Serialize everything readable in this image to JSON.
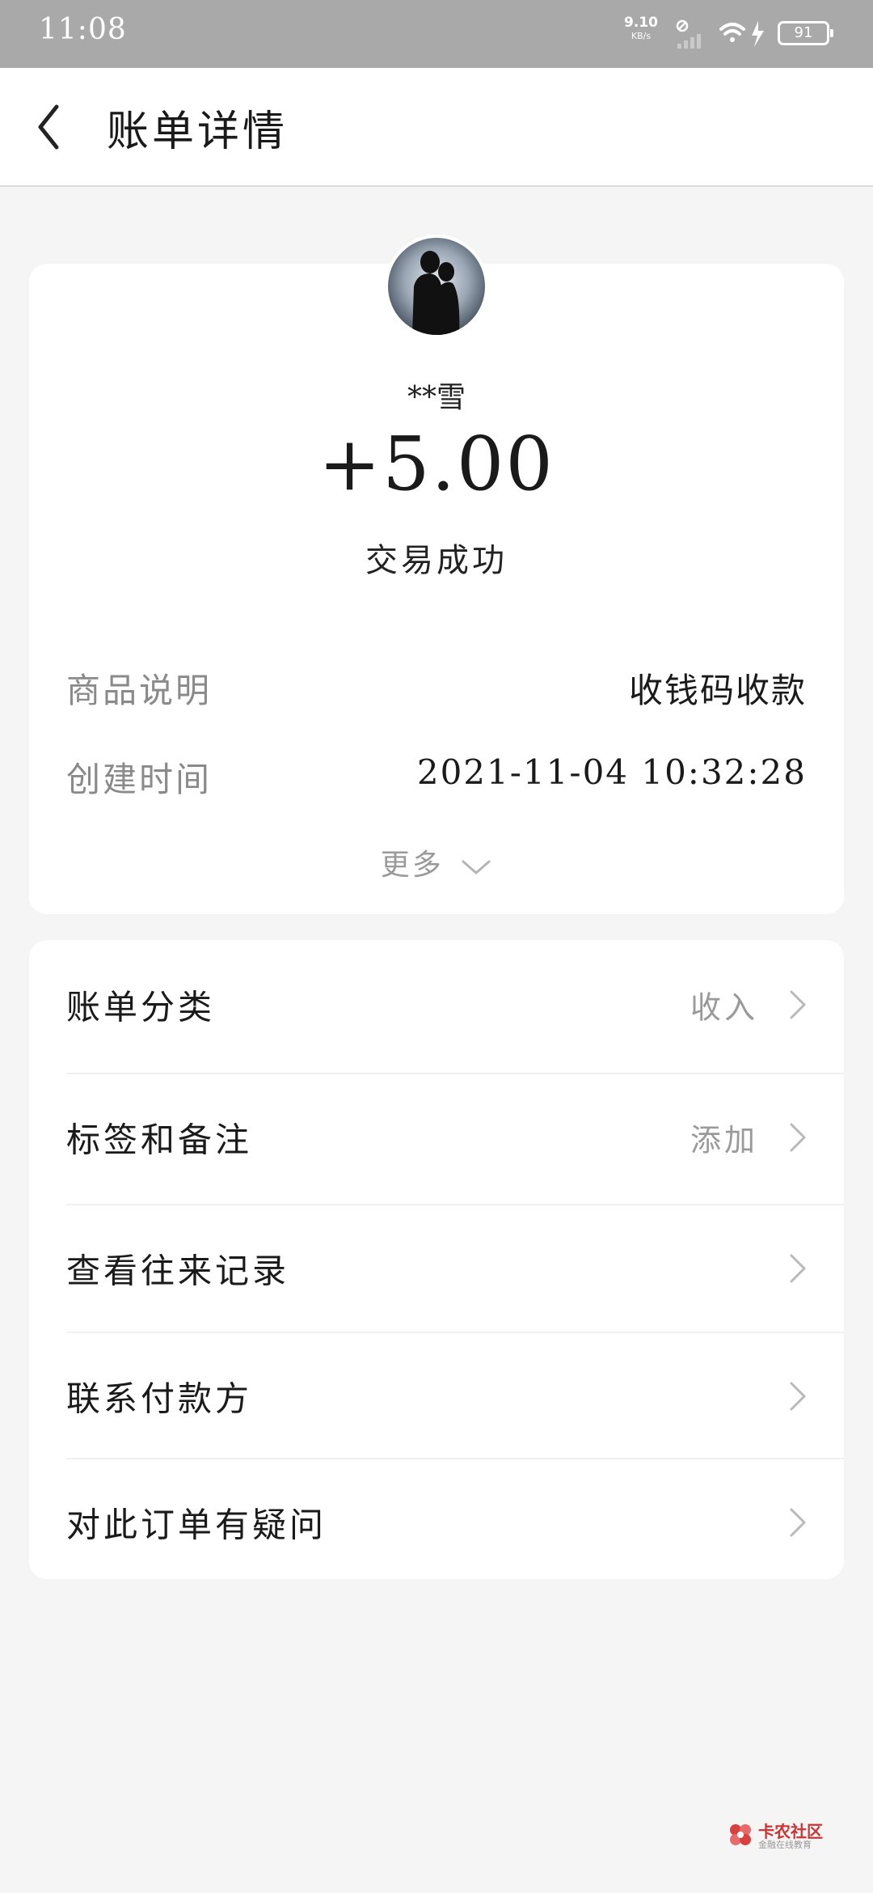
{
  "status_bar": {
    "time": "11:08",
    "net_speed": "9.10",
    "net_unit": "KB/s",
    "battery": "91"
  },
  "header": {
    "title": "账单详情"
  },
  "transaction": {
    "payer_name": "**雪",
    "amount": "+5.00",
    "status": "交易成功",
    "details": [
      {
        "label": "商品说明",
        "value": "收钱码收款"
      },
      {
        "label": "创建时间",
        "value": "2021-11-04 10:32:28"
      }
    ],
    "more_label": "更多"
  },
  "actions": [
    {
      "label": "账单分类",
      "value": "收入"
    },
    {
      "label": "标签和备注",
      "value": "添加"
    },
    {
      "label": "查看往来记录",
      "value": ""
    },
    {
      "label": "联系付款方",
      "value": ""
    },
    {
      "label": "对此订单有疑问",
      "value": ""
    }
  ],
  "watermark": {
    "brand": "卡农社区",
    "slogan": "金融在线教育"
  },
  "icons": {
    "back": "chevron-left-icon",
    "row_arrow": "chevron-right-icon",
    "more": "chevron-down-icon"
  }
}
